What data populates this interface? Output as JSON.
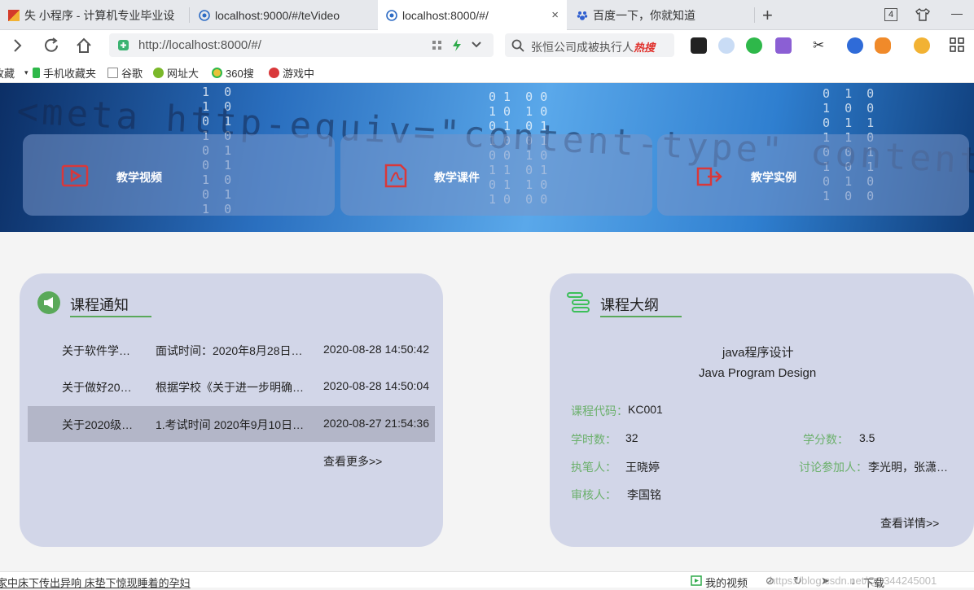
{
  "tabs": [
    {
      "title": "失 小程序 - 计算机专业毕业设"
    },
    {
      "title": "localhost:9000/#/teVideo"
    },
    {
      "title": "localhost:8000/#/",
      "close": "×"
    },
    {
      "title": "百度一下，你就知道"
    }
  ],
  "tabbar": {
    "new_tab": "+",
    "tab_count": "4",
    "minimize": "—"
  },
  "address": {
    "url": "http://localhost:8000/#/"
  },
  "search": {
    "text": "张恒公司成被执行人",
    "hot": "热搜"
  },
  "bookmarks": [
    "收藏",
    "手机收藏夹",
    "谷歌",
    "网址大",
    "360搜",
    "游戏中"
  ],
  "banner": {
    "code_text": "<meta http-equiv=\"content-type\" content",
    "cards": [
      {
        "label": "教学视频",
        "icon": "video-icon"
      },
      {
        "label": "教学课件",
        "icon": "pdf-icon"
      },
      {
        "label": "教学实例",
        "icon": "example-icon"
      }
    ]
  },
  "notice": {
    "title": "课程通知",
    "rows": [
      {
        "name": "关于软件学…",
        "desc": "面试时间：2020年8月28日…",
        "time": "2020-08-28 14:50:42"
      },
      {
        "name": "关于做好20…",
        "desc": "根据学校《关于进一步明确…",
        "time": "2020-08-28 14:50:04"
      },
      {
        "name": "关于2020级…",
        "desc": "1.考试时间 2020年9月10日…",
        "time": "2020-08-27 21:54:36"
      }
    ],
    "more": "查看更多>>"
  },
  "outline": {
    "title": "课程大纲",
    "course_cn": "java程序设计",
    "course_en": "Java Program Design",
    "code_label": "课程代码：",
    "code_value": "KC001",
    "hours_label": "学时数：",
    "hours_value": "32",
    "credit_label": "学分数：",
    "credit_value": "3.5",
    "author_label": "执笔人：",
    "author_value": "王晓婷",
    "discuss_label": "讨论参加人：",
    "discuss_value": "李光明，张潇…",
    "reviewer_label": "审核人：",
    "reviewer_value": "李国铭",
    "more": "查看详情>>"
  },
  "statusbar": {
    "news": "家中床下传出异响 床垫下惊现睡着的孕妇",
    "video": "我的视频",
    "download": "下载",
    "watermark": "https://blog.csdn.net/QQ344245001"
  },
  "colors": {
    "accent_green": "#5aa95a",
    "panel_bg": "#d2d6e8",
    "highlight_row": "#b3b6c8",
    "icon_red": "#d9383a"
  }
}
